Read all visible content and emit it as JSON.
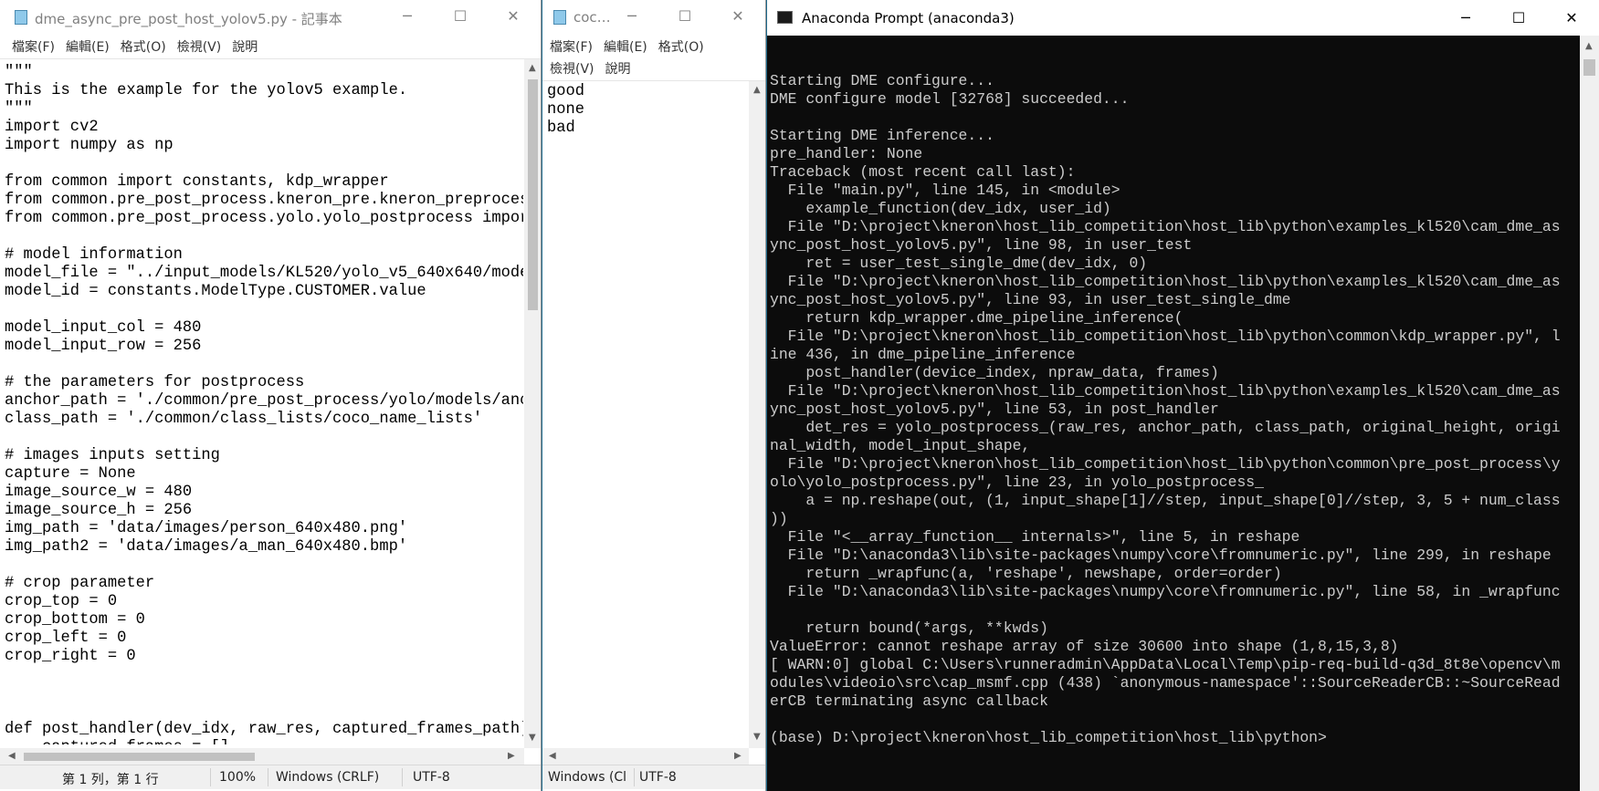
{
  "notepad1": {
    "title": "dme_async_pre_post_host_yolov5.py - 記事本",
    "menu": [
      "檔案(F)",
      "編輯(E)",
      "格式(O)",
      "檢視(V)",
      "說明"
    ],
    "code": "\"\"\"\nThis is the example for the yolov5 example.\n\"\"\"\nimport cv2\nimport numpy as np\n\nfrom common import constants, kdp_wrapper\nfrom common.pre_post_process.kneron_pre.kneron_preprocess\nfrom common.pre_post_process.yolo.yolo_postprocess import\n\n# model information\nmodel_file = \"../input_models/KL520/yolo_v5_640x640/model\nmodel_id = constants.ModelType.CUSTOMER.value\n\nmodel_input_col = 480\nmodel_input_row = 256\n\n# the parameters for postprocess\nanchor_path = './common/pre_post_process/yolo/models/anch\nclass_path = './common/class_lists/coco_name_lists'\n\n# images inputs setting\ncapture = None\nimage_source_w = 480\nimage_source_h = 256\nimg_path = 'data/images/person_640x480.png'\nimg_path2 = 'data/images/a_man_640x480.bmp'\n\n# crop parameter\ncrop_top = 0\ncrop_bottom = 0\ncrop_left = 0\ncrop_right = 0\n\n\n\ndef post_handler(dev_idx, raw_res, captured_frames_path):\n    captured_frames = []",
    "status": {
      "position": "第 1 列，第 1 行",
      "zoom": "100%",
      "line_ending": "Windows (CRLF)",
      "encoding": "UTF-8"
    }
  },
  "notepad2": {
    "title": "coc…",
    "menu_row1": [
      "檔案(F)",
      "編輯(E)",
      "格式(O)"
    ],
    "menu_row2": [
      "檢視(V)",
      "說明"
    ],
    "text": "good\nnone\nbad",
    "status": {
      "line_ending": "Windows (Cl",
      "encoding": "UTF-8"
    }
  },
  "console": {
    "title": "Anaconda Prompt (anaconda3)",
    "output": "Starting DME configure...\nDME configure model [32768] succeeded...\n\nStarting DME inference...\npre_handler: None\nTraceback (most recent call last):\n  File \"main.py\", line 145, in <module>\n    example_function(dev_idx, user_id)\n  File \"D:\\project\\kneron\\host_lib_competition\\host_lib\\python\\examples_kl520\\cam_dme_as\nync_post_host_yolov5.py\", line 98, in user_test\n    ret = user_test_single_dme(dev_idx, 0)\n  File \"D:\\project\\kneron\\host_lib_competition\\host_lib\\python\\examples_kl520\\cam_dme_as\nync_post_host_yolov5.py\", line 93, in user_test_single_dme\n    return kdp_wrapper.dme_pipeline_inference(\n  File \"D:\\project\\kneron\\host_lib_competition\\host_lib\\python\\common\\kdp_wrapper.py\", l\nine 436, in dme_pipeline_inference\n    post_handler(device_index, npraw_data, frames)\n  File \"D:\\project\\kneron\\host_lib_competition\\host_lib\\python\\examples_kl520\\cam_dme_as\nync_post_host_yolov5.py\", line 53, in post_handler\n    det_res = yolo_postprocess_(raw_res, anchor_path, class_path, original_height, origi\nnal_width, model_input_shape,\n  File \"D:\\project\\kneron\\host_lib_competition\\host_lib\\python\\common\\pre_post_process\\y\nolo\\yolo_postprocess.py\", line 23, in yolo_postprocess_\n    a = np.reshape(out, (1, input_shape[1]//step, input_shape[0]//step, 3, 5 + num_class\n))\n  File \"<__array_function__ internals>\", line 5, in reshape\n  File \"D:\\anaconda3\\lib\\site-packages\\numpy\\core\\fromnumeric.py\", line 299, in reshape\n    return _wrapfunc(a, 'reshape', newshape, order=order)\n  File \"D:\\anaconda3\\lib\\site-packages\\numpy\\core\\fromnumeric.py\", line 58, in _wrapfunc\n\n    return bound(*args, **kwds)\nValueError: cannot reshape array of size 30600 into shape (1,8,15,3,8)\n[ WARN:0] global C:\\Users\\runneradmin\\AppData\\Local\\Temp\\pip-req-build-q3d_8t8e\\opencv\\m\nodules\\videoio\\src\\cap_msmf.cpp (438) `anonymous-namespace'::SourceReaderCB::~SourceRead\nerCB terminating async callback\n\n(base) D:\\project\\kneron\\host_lib_competition\\host_lib\\python>"
  },
  "window_controls": {
    "minimize": "─",
    "maximize": "☐",
    "close": "✕"
  },
  "icons": [
    "notepad-icon",
    "cmd-icon"
  ]
}
